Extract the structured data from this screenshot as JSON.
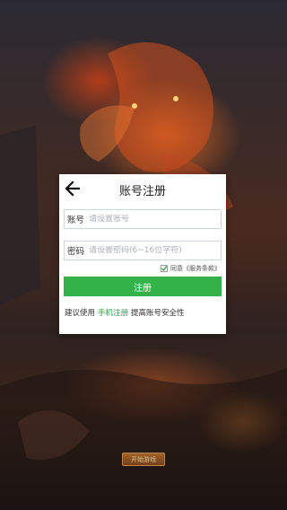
{
  "dialog": {
    "title": "账号注册",
    "account": {
      "label": "账号",
      "placeholder": "请设置账号",
      "value": ""
    },
    "password": {
      "label": "密码",
      "placeholder": "请设置密码(6~16位字符)",
      "value": ""
    },
    "agree": {
      "checked": true,
      "text": "同意《服务条款》"
    },
    "register_label": "注册",
    "tip": {
      "prefix": "建议使用",
      "link": "手机注册",
      "suffix": "提高账号安全性"
    }
  },
  "background": {
    "start_button_label": "开始游戏"
  },
  "colors": {
    "accent": "#34b24a",
    "link": "#2fa83e",
    "input_border": "#cfd8e0"
  },
  "icons": {
    "back": "back-arrow-icon",
    "checkbox": "checkbox-checked-icon"
  }
}
